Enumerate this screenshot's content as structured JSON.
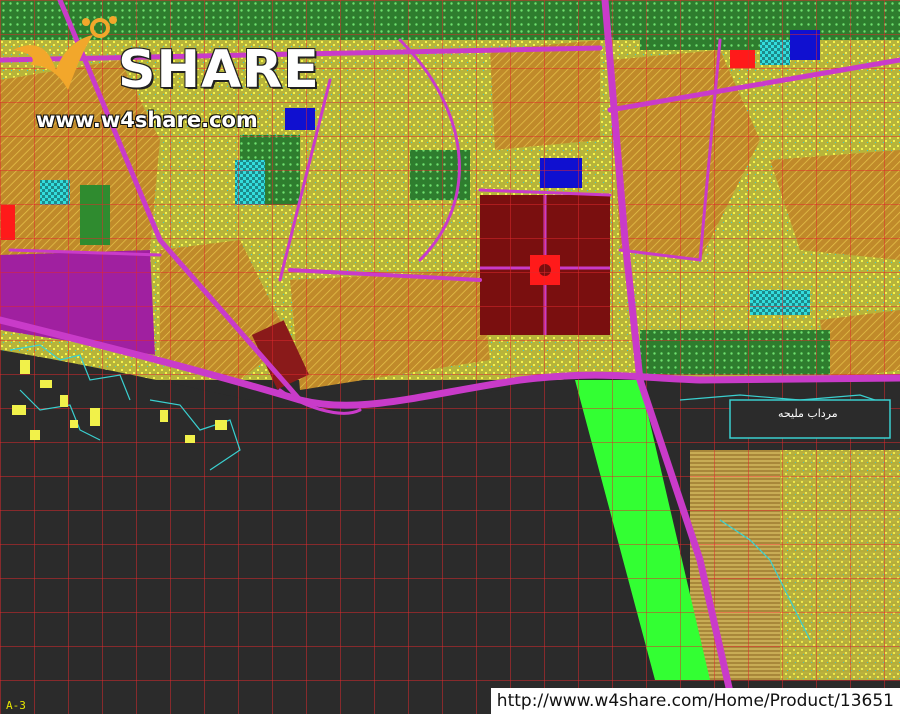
{
  "watermark": {
    "brand_text": "SHARE",
    "site_text": "www.w4share.com",
    "product_url": "http://www.w4share.com/Home/Product/13651",
    "brand_color": "#f2a72b"
  },
  "map": {
    "sheet_label": "A-3",
    "place_label": "مرداب ملیحه",
    "colors": {
      "background": "#2b2b2b",
      "grid": "#e0282c",
      "roads": "#c93bc9",
      "residential": "#c08a2a",
      "buildings": "#f1f14a",
      "green_space": "#2e8b2e",
      "bright_green": "#33ff33",
      "water": "#3aa3c9",
      "blue_blocks": "#1010d0",
      "cyan_blocks": "#2ad0d0",
      "magenta": "#a020a0",
      "center_dark_red": "#7a0f0f",
      "highlight_red": "#ff1a1a"
    }
  }
}
